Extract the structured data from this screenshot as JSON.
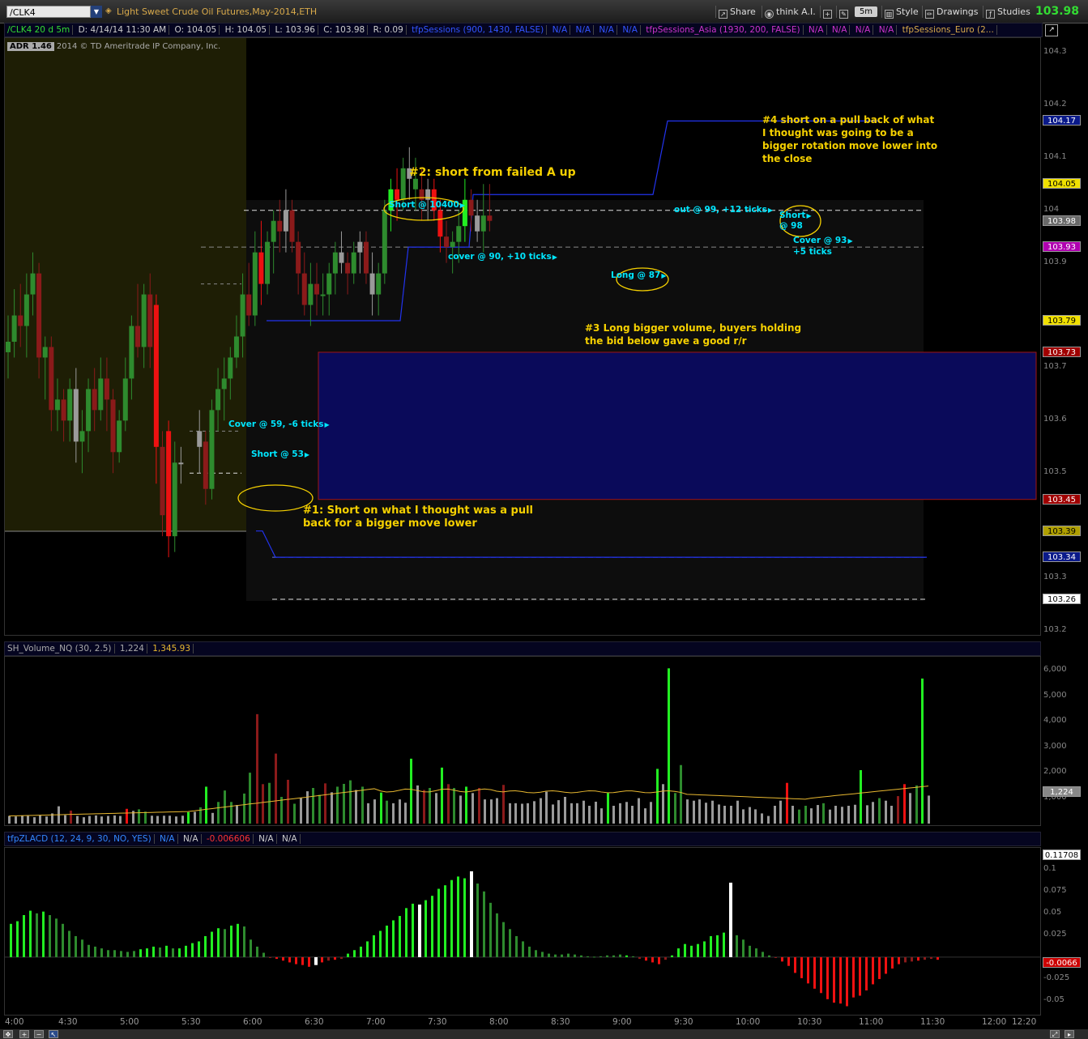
{
  "toolbar": {
    "symbol": "/CLK4",
    "description": "Light Sweet Crude Oil Futures,May-2014,ETH",
    "share": "Share",
    "think": "think A.I.",
    "timeframe": "5m",
    "style": "Style",
    "drawings": "Drawings",
    "studies": "Studies",
    "last_price": "103.98"
  },
  "price_header": {
    "symbol": "/CLK4 20 d 5m",
    "date": "D: 4/14/14 11:30 AM",
    "open": "O: 104.05",
    "high": "H: 104.05",
    "low": "L: 103.96",
    "close": "C: 103.98",
    "range": "R: 0.09",
    "study1": "tfpSessions (900, 1430, FALSE)",
    "na": "N/A",
    "study2": "tfpSessions_Asia (1930, 200, FALSE)",
    "study3": "tfpSessions_Euro (2..."
  },
  "adr": "ADR 1.46",
  "copyright": "2014 © TD Ameritrade IP Company, Inc.",
  "price_axis": {
    "labels": [
      "104.3",
      "104.2",
      "104.1",
      "104",
      "103.9",
      "103.7",
      "103.6",
      "103.5",
      "103.3",
      "103.2"
    ],
    "tags": [
      {
        "text": "104.17",
        "bg": "#0a1a8a",
        "fg": "#ffffff"
      },
      {
        "text": "104.05",
        "bg": "#f0e000",
        "fg": "#000000"
      },
      {
        "text": "103.98",
        "bg": "#6a6a6a",
        "fg": "#ffffff"
      },
      {
        "text": "103.93",
        "bg": "#b000b0",
        "fg": "#ffffff"
      },
      {
        "text": "103.79",
        "bg": "#f0e000",
        "fg": "#000000"
      },
      {
        "text": "103.73",
        "bg": "#a00000",
        "fg": "#ffffff"
      },
      {
        "text": "103.45",
        "bg": "#a00000",
        "fg": "#ffffff"
      },
      {
        "text": "103.39",
        "bg": "#b0a000",
        "fg": "#000000"
      },
      {
        "text": "103.34",
        "bg": "#0a1a8a",
        "fg": "#ffffff"
      },
      {
        "text": "103.26",
        "bg": "#ffffff",
        "fg": "#000000"
      }
    ]
  },
  "notes": {
    "n1": "#1: Short on what I thought was a pull back for a bigger move lower",
    "n2": "#2: short from failed A up",
    "n3": "#3 Long bigger volume, buyers holding the bid below gave a good r/r",
    "n4": "#4 short on a pull back of what I thought was going to be a bigger rotation move lower into the close"
  },
  "trade_labels": {
    "cover59": "Cover @ 59, -6 ticks",
    "short53": "Short @ 53",
    "short10400": "Short @ 10400",
    "cover90": "cover @ 90, +10 ticks",
    "long87": "Long @ 87",
    "out99": "out @ 99, +12 ticks",
    "short98a": "Short",
    "short98b": "@ 98",
    "cover93a": "Cover @ 93",
    "cover93b": "+5 ticks"
  },
  "volume_header": {
    "study": "SH_Volume_NQ (30, 2.5)",
    "value": "1,224",
    "avg": "1,345.93"
  },
  "volume_axis": {
    "labels": [
      "6,000",
      "5,000",
      "4,000",
      "3,000",
      "2,000",
      "1,000"
    ],
    "tag": "1,224"
  },
  "zlacd_header": {
    "study": "tfpZLACD (12, 24, 9, 30, NO, YES)",
    "na": "N/A",
    "value": "-0.006606"
  },
  "zlacd_axis": {
    "labels": [
      "0.1",
      "0.075",
      "0.05",
      "0.025",
      "-0.025",
      "-0.05"
    ],
    "tag_top": "0.11708",
    "tag_val": "-0.0066"
  },
  "time_axis": [
    "4:00",
    "4:30",
    "5:00",
    "5:30",
    "6:00",
    "6:30",
    "7:00",
    "7:30",
    "8:00",
    "8:30",
    "9:00",
    "9:30",
    "10:00",
    "10:30",
    "11:00",
    "11:30",
    "12:00",
    "12:20"
  ],
  "colors": {
    "up": "#2e8b2e",
    "up_bright": "#22ee22",
    "down": "#8b1a1a",
    "down_bright": "#ee1111",
    "neutral": "#9a9a9a",
    "zone": "#0a0a5a",
    "note": "#f5d000",
    "label": "#00e6ff"
  },
  "chart_data": {
    "type": "candlestick",
    "title": "Light Sweet Crude Oil Futures,May-2014,ETH",
    "interval": "5m",
    "ylim": [
      103.2,
      104.32
    ],
    "x_start": "4:00",
    "x_end": "12:20",
    "candles": [
      [
        "4:00",
        103.73,
        103.8,
        103.68,
        103.75,
        "up"
      ],
      [
        "4:05",
        103.75,
        103.85,
        103.72,
        103.8,
        "up"
      ],
      [
        "4:10",
        103.8,
        103.86,
        103.74,
        103.78,
        "down"
      ],
      [
        "4:15",
        103.78,
        103.88,
        103.72,
        103.84,
        "up"
      ],
      [
        "4:20",
        103.84,
        103.92,
        103.8,
        103.88,
        "up"
      ],
      [
        "4:25",
        103.88,
        103.9,
        103.68,
        103.72,
        "down"
      ],
      [
        "4:30",
        103.72,
        103.76,
        103.64,
        103.74,
        "up"
      ],
      [
        "4:35",
        103.74,
        103.76,
        103.58,
        103.62,
        "down"
      ],
      [
        "4:40",
        103.62,
        103.68,
        103.58,
        103.64,
        "up"
      ],
      [
        "4:45",
        103.64,
        103.66,
        103.56,
        103.6,
        "down"
      ],
      [
        "4:50",
        103.6,
        103.68,
        103.56,
        103.66,
        "up"
      ],
      [
        "4:55",
        103.66,
        103.7,
        103.52,
        103.56,
        "neutral"
      ],
      [
        "5:00",
        103.56,
        103.62,
        103.5,
        103.58,
        "up"
      ],
      [
        "5:05",
        103.58,
        103.68,
        103.54,
        103.66,
        "up"
      ],
      [
        "5:10",
        103.66,
        103.7,
        103.58,
        103.62,
        "down"
      ],
      [
        "5:15",
        103.62,
        103.72,
        103.6,
        103.68,
        "up"
      ],
      [
        "5:20",
        103.68,
        103.72,
        103.58,
        103.64,
        "down"
      ],
      [
        "5:25",
        103.64,
        103.66,
        103.5,
        103.54,
        "down"
      ],
      [
        "5:30",
        103.54,
        103.62,
        103.52,
        103.6,
        "up"
      ],
      [
        "5:35",
        103.6,
        103.72,
        103.58,
        103.68,
        "up"
      ],
      [
        "5:40",
        103.68,
        103.8,
        103.64,
        103.78,
        "up"
      ],
      [
        "5:45",
        103.78,
        103.86,
        103.72,
        103.74,
        "down"
      ],
      [
        "5:50",
        103.74,
        103.86,
        103.7,
        103.84,
        "up"
      ],
      [
        "5:55",
        103.84,
        103.88,
        103.7,
        103.74,
        "down"
      ],
      [
        "6:00",
        103.82,
        103.84,
        103.48,
        103.55,
        "down_bright"
      ],
      [
        "6:05",
        103.55,
        103.58,
        103.38,
        103.42,
        "down"
      ],
      [
        "6:10",
        103.58,
        103.6,
        103.34,
        103.38,
        "down_bright"
      ],
      [
        "6:15",
        103.38,
        103.56,
        103.35,
        103.52,
        "up"
      ],
      [
        "6:20",
        103.52,
        103.55,
        103.48,
        103.52,
        "neutral"
      ],
      [
        "6:35",
        103.58,
        103.62,
        103.5,
        103.55,
        "neutral"
      ],
      [
        "6:40",
        103.56,
        103.58,
        103.44,
        103.47,
        "down"
      ],
      [
        "6:45",
        103.47,
        103.64,
        103.45,
        103.62,
        "up"
      ],
      [
        "6:50",
        103.62,
        103.7,
        103.58,
        103.66,
        "up"
      ],
      [
        "6:55",
        103.66,
        103.72,
        103.6,
        103.68,
        "up"
      ],
      [
        "7:00",
        103.68,
        103.74,
        103.64,
        103.72,
        "up"
      ],
      [
        "7:05",
        103.72,
        103.8,
        103.7,
        103.76,
        "up"
      ],
      [
        "7:10",
        103.76,
        103.88,
        103.72,
        103.84,
        "up"
      ],
      [
        "7:15",
        103.84,
        103.9,
        103.78,
        103.8,
        "down"
      ],
      [
        "7:20",
        103.8,
        103.96,
        103.78,
        103.92,
        "up"
      ],
      [
        "7:25",
        103.92,
        103.98,
        103.82,
        103.86,
        "down_bright"
      ],
      [
        "7:30",
        103.86,
        103.96,
        103.84,
        103.94,
        "up"
      ],
      [
        "7:35",
        103.94,
        104.0,
        103.88,
        103.98,
        "up"
      ],
      [
        "7:40",
        103.98,
        104.02,
        103.92,
        103.96,
        "down"
      ],
      [
        "7:45",
        103.96,
        104.04,
        103.92,
        104.0,
        "neutral"
      ],
      [
        "7:50",
        104.0,
        104.02,
        103.92,
        103.94,
        "down"
      ],
      [
        "7:55",
        103.94,
        103.96,
        103.84,
        103.88,
        "down"
      ],
      [
        "8:00",
        103.88,
        103.92,
        103.8,
        103.82,
        "down"
      ],
      [
        "8:05",
        103.82,
        103.9,
        103.78,
        103.86,
        "up"
      ],
      [
        "8:10",
        103.86,
        103.9,
        103.8,
        103.84,
        "down"
      ],
      [
        "8:15",
        103.84,
        103.88,
        103.8,
        103.84,
        "up"
      ],
      [
        "8:20",
        103.84,
        103.9,
        103.8,
        103.88,
        "up"
      ],
      [
        "8:25",
        103.88,
        103.94,
        103.84,
        103.92,
        "up"
      ],
      [
        "8:30",
        103.92,
        103.96,
        103.88,
        103.9,
        "neutral"
      ],
      [
        "8:35",
        103.9,
        103.92,
        103.84,
        103.88,
        "down"
      ],
      [
        "8:40",
        103.88,
        103.94,
        103.86,
        103.92,
        "up"
      ],
      [
        "8:45",
        103.92,
        103.96,
        103.88,
        103.94,
        "neutral"
      ],
      [
        "8:50",
        103.94,
        103.96,
        103.86,
        103.88,
        "down"
      ],
      [
        "8:55",
        103.88,
        103.92,
        103.8,
        103.84,
        "neutral"
      ],
      [
        "9:00",
        103.84,
        103.9,
        103.8,
        103.88,
        "up"
      ],
      [
        "9:05",
        103.88,
        104.02,
        103.86,
        104.0,
        "up"
      ],
      [
        "9:10",
        104.0,
        104.06,
        103.96,
        104.04,
        "up_bright"
      ],
      [
        "9:15",
        104.04,
        104.08,
        103.98,
        104.02,
        "down_bright"
      ],
      [
        "9:20",
        104.02,
        104.1,
        104.0,
        104.08,
        "up"
      ],
      [
        "9:25",
        104.08,
        104.12,
        104.02,
        104.06,
        "neutral"
      ],
      [
        "9:30",
        104.06,
        104.1,
        104.0,
        104.04,
        "up"
      ],
      [
        "9:35",
        104.04,
        104.08,
        103.98,
        104.02,
        "down"
      ],
      [
        "9:40",
        104.02,
        104.06,
        103.98,
        104.04,
        "neutral"
      ],
      [
        "9:45",
        104.04,
        104.06,
        103.98,
        104.0,
        "down_bright"
      ],
      [
        "9:50",
        104.0,
        104.02,
        103.92,
        103.95,
        "down_bright"
      ],
      [
        "9:55",
        103.95,
        103.98,
        103.9,
        103.93,
        "down"
      ],
      [
        "10:00",
        103.93,
        103.96,
        103.88,
        103.94,
        "up"
      ],
      [
        "10:05",
        103.94,
        104.0,
        103.9,
        103.97,
        "up"
      ],
      [
        "10:10",
        103.97,
        104.06,
        103.94,
        104.02,
        "up_bright"
      ],
      [
        "10:15",
        104.02,
        104.04,
        103.96,
        103.99,
        "down"
      ],
      [
        "10:20",
        103.99,
        104.02,
        103.94,
        103.96,
        "neutral"
      ],
      [
        "10:25",
        103.96,
        104.05,
        103.92,
        103.99,
        "up"
      ],
      [
        "10:30",
        103.99,
        104.05,
        103.96,
        103.98,
        "down"
      ]
    ]
  }
}
